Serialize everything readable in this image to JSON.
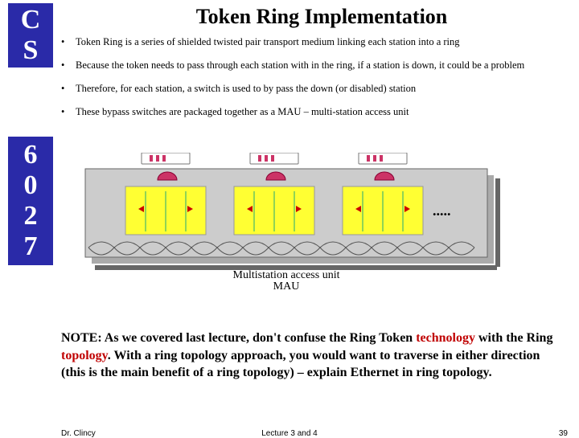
{
  "sidebar": {
    "top": [
      "C",
      "S"
    ],
    "bottom": [
      "6",
      "0",
      "2",
      "7"
    ]
  },
  "title": "Token Ring Implementation",
  "bullets": [
    "Token Ring is a series of shielded twisted pair transport medium linking each station into a ring",
    "Because the token needs to pass through each station with in the ring, if a station is down, it could be a problem",
    "Therefore, for each station, a switch is used to by pass the down (or disabled) station",
    "These bypass switches are packaged together as a MAU – multi-station access unit"
  ],
  "diagram": {
    "caption": "Multistation access unit\nMAU",
    "stations": 3,
    "mau_nodes": 3,
    "colors": {
      "mau_bg": "#ffff33",
      "ring_bg": "#cccccc",
      "plug": "#cc3366",
      "station": "#ffffff"
    }
  },
  "note": {
    "pre": "NOTE: As we covered last lecture, don't confuse the Ring Token ",
    "tech": "technology",
    "mid": " with the Ring ",
    "topo": "topology",
    "post": ". With a ring topology approach, you would want to traverse in either direction (this is the main benefit of a ring topology) – explain Ethernet in ring topology."
  },
  "footer": {
    "left": "Dr. Clincy",
    "center": "Lecture 3 and 4",
    "right": "39"
  }
}
